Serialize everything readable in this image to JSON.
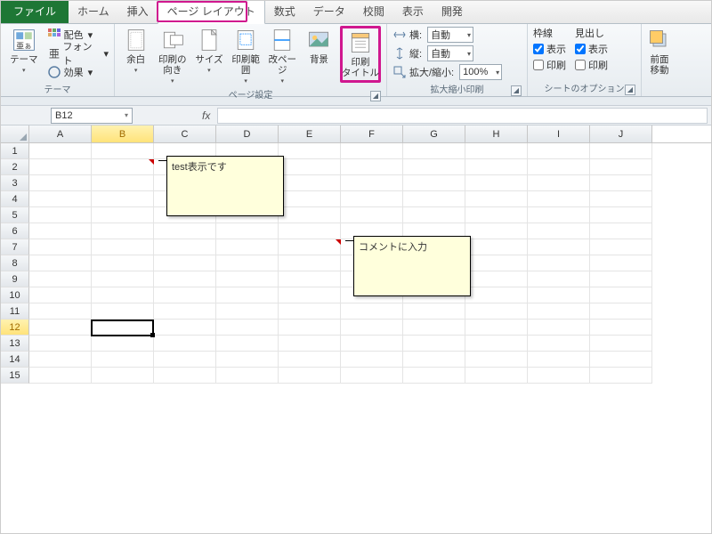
{
  "tabs": {
    "file": "ファイル",
    "home": "ホーム",
    "insert": "挿入",
    "pagelayout": "ページ レイアウト",
    "formulas": "数式",
    "data": "データ",
    "review": "校閲",
    "view": "表示",
    "developer": "開発"
  },
  "ribbon": {
    "themes": {
      "themes": "テーマ",
      "colors": "配色",
      "fonts": "フォント",
      "effects": "効果",
      "group": "テーマ"
    },
    "pagesetup": {
      "margins": "余白",
      "orientation": "印刷の\n向き",
      "size": "サイズ",
      "printarea": "印刷範囲",
      "breaks": "改ページ",
      "background": "背景",
      "printtitles": "印刷\nタイトル",
      "group": "ページ設定"
    },
    "scale": {
      "width_lbl": "横:",
      "height_lbl": "縦:",
      "scale_lbl": "拡大/縮小:",
      "auto": "自動",
      "scale_val": "100%",
      "group": "拡大縮小印刷"
    },
    "sheetopts": {
      "gridlines": "枠線",
      "headings": "見出し",
      "view": "表示",
      "print": "印刷",
      "group": "シートのオプション"
    },
    "arrange": {
      "bringfwd": "前面\n移動"
    }
  },
  "namebox": "B12",
  "columns": [
    "A",
    "B",
    "C",
    "D",
    "E",
    "F",
    "G",
    "H",
    "I",
    "J"
  ],
  "rows": [
    1,
    2,
    3,
    4,
    5,
    6,
    7,
    8,
    9,
    10,
    11,
    12,
    13,
    14,
    15
  ],
  "selected_col": "B",
  "selected_row": 12,
  "comments": {
    "c1": "test表示です",
    "c2": "コメントに入力"
  }
}
